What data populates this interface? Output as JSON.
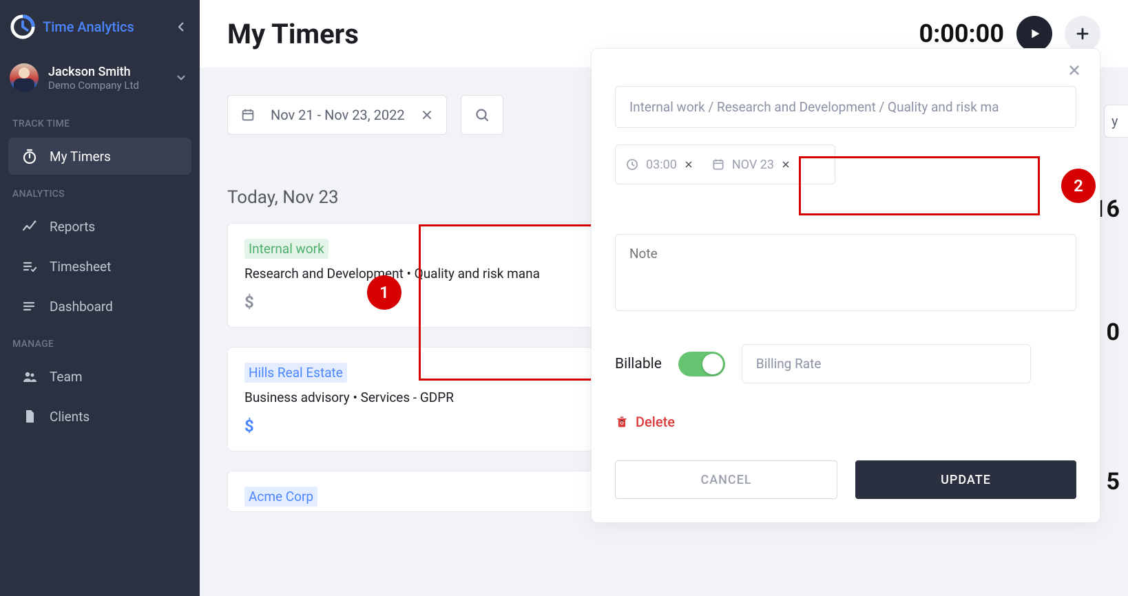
{
  "app_name": "Time Analytics",
  "page_title": "My Timers",
  "timer": "0:00:00",
  "user": {
    "name": "Jackson Smith",
    "company": "Demo Company Ltd"
  },
  "sidebar": {
    "section_track": "TRACK TIME",
    "section_analytics": "ANALYTICS",
    "section_manage": "MANAGE",
    "items": {
      "my_timers": "My Timers",
      "reports": "Reports",
      "timesheet": "Timesheet",
      "dashboard": "Dashboard",
      "team": "Team",
      "clients": "Clients"
    }
  },
  "filters": {
    "date_range": "Nov 21 - Nov 23, 2022",
    "day_chip_fragment": "y"
  },
  "day_header": "Today, Nov 23",
  "truncated_values": {
    "r1": ":16",
    "r2": "0",
    "r3": "5"
  },
  "cards": [
    {
      "client": "Internal work",
      "tag_class": "tag-green",
      "line2": "Research and Development • Quality and risk mana",
      "dollar_class": "dollar-gray"
    },
    {
      "client": "Hills Real Estate",
      "tag_class": "tag-blue",
      "line2": "Business advisory • Services - GDPR",
      "dollar_class": "dollar-blue"
    },
    {
      "client": "Acme Corp",
      "tag_class": "tag-blue",
      "line2": "",
      "dollar_class": "dollar-blue"
    }
  ],
  "popup": {
    "task_text": "Internal work / Research and Development / Quality and risk ma",
    "time_value": "03:00",
    "date_value": "NOV 23",
    "note_placeholder": "Note",
    "billable_label": "Billable",
    "billable_on": true,
    "rate_placeholder": "Billing Rate",
    "delete_label": "Delete",
    "cancel_label": "CANCEL",
    "update_label": "UPDATE"
  },
  "annotations": {
    "n1": "1",
    "n2": "2"
  }
}
